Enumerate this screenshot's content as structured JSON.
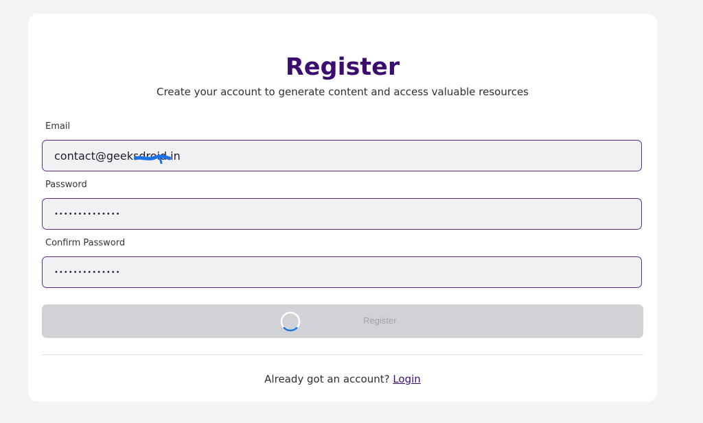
{
  "page": {
    "background_color": "#f2f3f5"
  },
  "form": {
    "title": "Register",
    "subtitle": "Create your account to generate content and access valuable resources",
    "email": {
      "label": "Email",
      "value": "contact@geeksdroid.in"
    },
    "password": {
      "label": "Password",
      "value": "••••••••••••••"
    },
    "confirm_password": {
      "label": "Confirm Password",
      "value": "••••••••••••••"
    },
    "submit": {
      "label": "Register",
      "state": "loading",
      "spinner_icon": "loading-spinner-icon"
    },
    "footer": {
      "prompt": "Already got an account?",
      "link_label": "Login"
    }
  },
  "colors": {
    "title": "#3b0d6e",
    "field_border": "#5a2a8e",
    "field_background": "#f1f1f4",
    "button_disabled_background": "#d1d2d6",
    "spinner_accent": "#1a73e8",
    "redaction_scribble": "#1a73e8"
  }
}
